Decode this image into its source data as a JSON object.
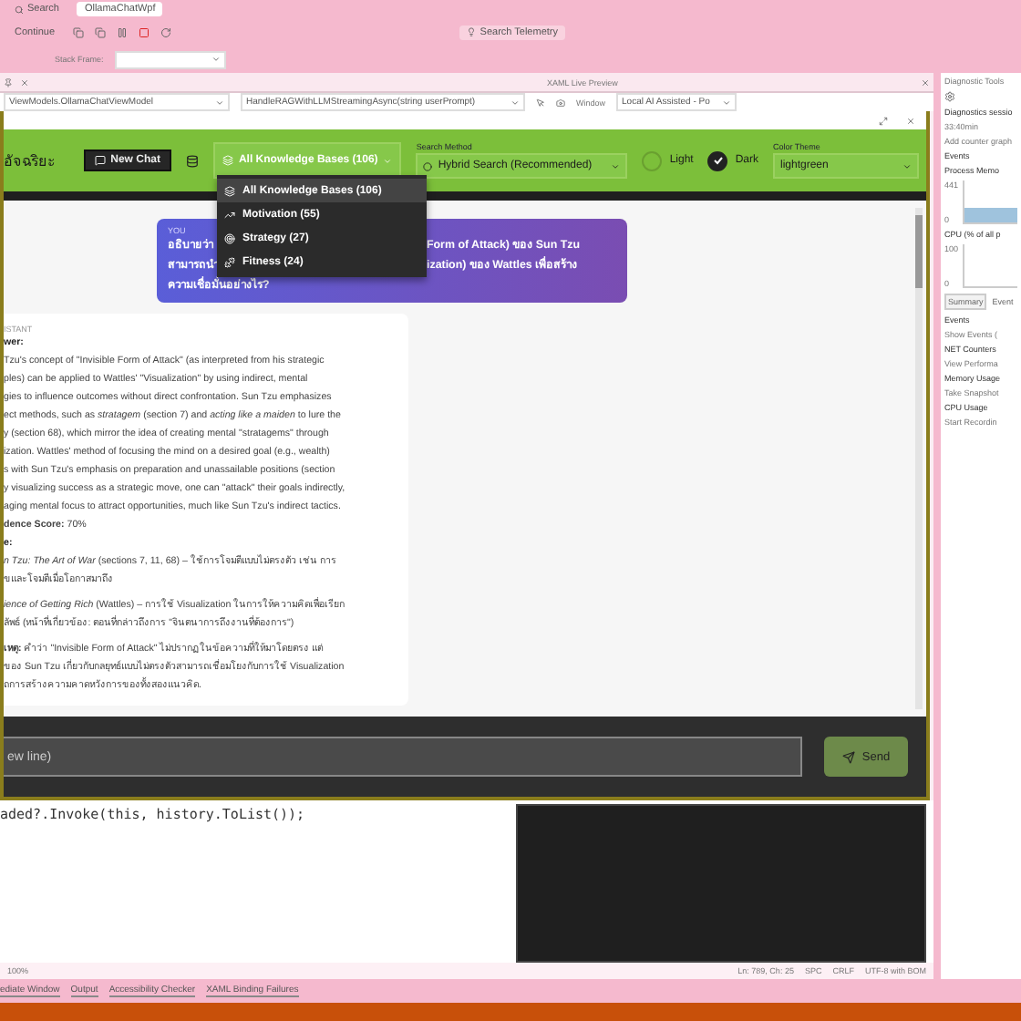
{
  "ide": {
    "search": "Search",
    "solution_tab": "OllamaChatWpf",
    "continue": "Continue",
    "telemetry": "Search Telemetry",
    "stack_frame_label": "Stack Frame:"
  },
  "editor": {
    "nav_left": "ViewModels.OllamaChatViewModel",
    "nav_right": "HandleRAGWithLLMStreamingAsync(string userPrompt)",
    "code_line": "aded?.Invoke(this, history.ToList());",
    "zoom": "100%",
    "status": [
      "Ln: 789, Ch: 25",
      "SPC",
      "CRLF",
      "UTF-8 with BOM"
    ]
  },
  "live_preview": {
    "title": "XAML Live Preview",
    "window_label": "Window",
    "window_combo": "Local AI Assisted - Po"
  },
  "app": {
    "title_fragment": "อัจฉริยะ",
    "new_chat": "New Chat",
    "kb_combo": "All Knowledge Bases (106)",
    "search_method_label": "Search Method",
    "search_method": "Hybrid Search (Recommended)",
    "themes": [
      {
        "label": "Light",
        "selected": false
      },
      {
        "label": "Dark",
        "selected": true
      }
    ],
    "color_theme_label": "Color Theme",
    "color_theme": "lightgreen",
    "kb_menu": [
      {
        "label": "All Knowledge Bases (106)",
        "selected": true
      },
      {
        "label": "Motivation (55)",
        "selected": false
      },
      {
        "label": "Strategy (27)",
        "selected": false
      },
      {
        "label": "Fitness (24)",
        "selected": false
      }
    ],
    "user_message": {
      "sender": "YOU",
      "lines": [
        {
          "left": "อธิบายว่า",
          "right": "Form of Attack) ของ Sun Tzu"
        },
        {
          "left": "สามารถนำ",
          "right": "ization) ของ Wattles เพื่อสร้าง"
        },
        {
          "left": "ความเชื่อมั่นอย่างไร?"
        }
      ]
    },
    "assistant_message": {
      "sender": "ISTANT",
      "lines": [
        {
          "kind": "heading",
          "text": "wer:"
        },
        {
          "kind": "body",
          "text": "Tzu's concept of \"Invisible Form of Attack\" (as interpreted from his strategic"
        },
        {
          "kind": "body",
          "text": "ples) can be applied to Wattles' \"Visualization\" by using indirect, mental"
        },
        {
          "kind": "body",
          "text": "gies to influence outcomes without direct confrontation. Sun Tzu emphasizes"
        },
        {
          "kind": "body",
          "text": "ect methods, such as *stratagem* (section 7) and *acting like a maiden* to lure the"
        },
        {
          "kind": "body",
          "text": "y (section 68), which mirror the idea of creating mental \"stratagems\" through"
        },
        {
          "kind": "body",
          "text": "ization. Wattles' method of focusing the mind on a desired goal (e.g., wealth)"
        },
        {
          "kind": "body",
          "text": "s with Sun Tzu's emphasis on preparation and unassailable positions (section"
        },
        {
          "kind": "body",
          "text": "y visualizing success as a strategic move, one can \"attack\" their goals indirectly,"
        },
        {
          "kind": "body",
          "text": "aging mental focus to attract opportunities, much like Sun Tzu's indirect tactics."
        },
        {
          "kind": "body",
          "text": "**dence Score:** 70%"
        },
        {
          "kind": "heading",
          "text": "e:"
        },
        {
          "kind": "body",
          "text": "*n Tzu: The Art of War* (sections 7, 11, 68) – ใช้การโจมตีแบบไม่ตรงตัว เช่น การ"
        },
        {
          "kind": "body",
          "text": "ขและโจมตีเมื่อโอกาสมาถึง"
        },
        {
          "kind": "item",
          "text": "*ience of Getting Rich* (Wattles) – การใช้ Visualization ในการให้ความคิดเพื่อเรียก"
        },
        {
          "kind": "body",
          "text": "ลัพธ์ (หน้าที่เกี่ยวข้อง: ตอนที่กล่าวถึงการ \"จินตนาการถึงงานที่ต้องการ\")"
        },
        {
          "kind": "item",
          "text": "**เหตุ:** คำว่า \"Invisible Form of Attack\" ไม่ปรากฏในข้อความที่ให้มาโดยตรง แต่"
        },
        {
          "kind": "body",
          "text": "ของ Sun Tzu เกี่ยวกับกลยุทธ์แบบไม่ตรงตัวสามารถเชื่อมโยงกับการใช้ Visualization"
        },
        {
          "kind": "body",
          "text": "ถการสร้างความคาดหวังการของทั้งสองแนวคิด."
        }
      ]
    },
    "input_placeholder": "ew line)",
    "send": "Send"
  },
  "diagnostics": {
    "title": "Diagnostic Tools",
    "session": "Diagnostics sessio",
    "duration": "33:40min",
    "add_counter": "Add counter graph",
    "events": "Events",
    "memory": "Process Memo",
    "memory_max": "441",
    "memory_min": "0",
    "cpu": "CPU (% of all p",
    "cpu_max": "100",
    "cpu_min": "0",
    "tabs": [
      {
        "label": "Summary",
        "selected": true
      },
      {
        "label": "Event",
        "selected": false
      }
    ],
    "sections": [
      {
        "heading": "Events",
        "action": "Show Events ("
      },
      {
        "heading": "NET Counters",
        "action": "View Performa"
      },
      {
        "heading": "Memory Usage",
        "action": "Take Snapshot"
      },
      {
        "heading": "CPU Usage",
        "action": "Start Recordin"
      }
    ]
  },
  "bottom_tabs": [
    "ediate Window",
    "Output",
    "Accessibility Checker",
    "XAML Binding Failures"
  ]
}
